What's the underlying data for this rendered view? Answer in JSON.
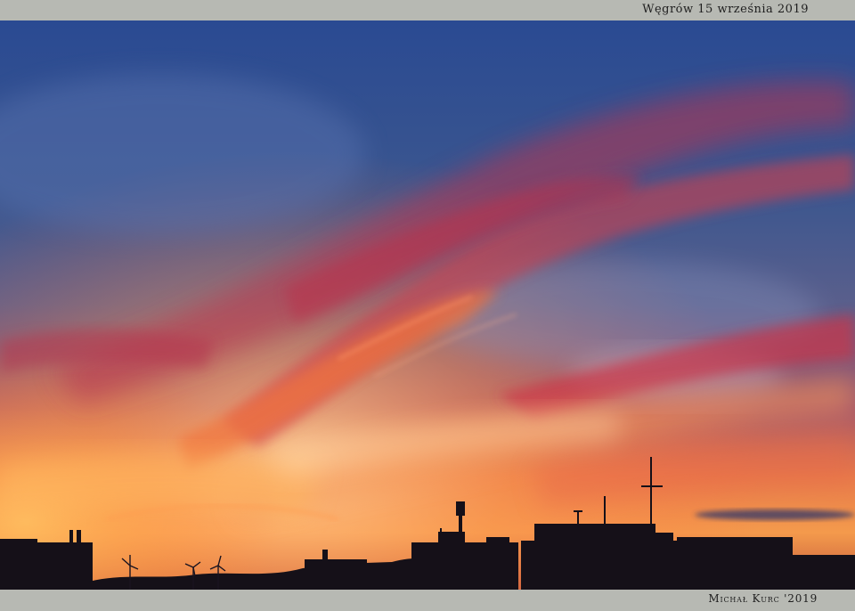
{
  "caption": {
    "top": "Węgrów 15 września 2019",
    "bottom": "Michał Kurc '2019"
  },
  "photo": {
    "subject": "sunset sky with red and orange clouds over building silhouettes",
    "colors": {
      "sky_top": "#2c4a8e",
      "sky_mid": "#5f6aa0",
      "cloud_red": "#c5364a",
      "cloud_orange": "#f07a3c",
      "horizon_glow": "#ffb35a",
      "silhouette": "#141018"
    }
  }
}
